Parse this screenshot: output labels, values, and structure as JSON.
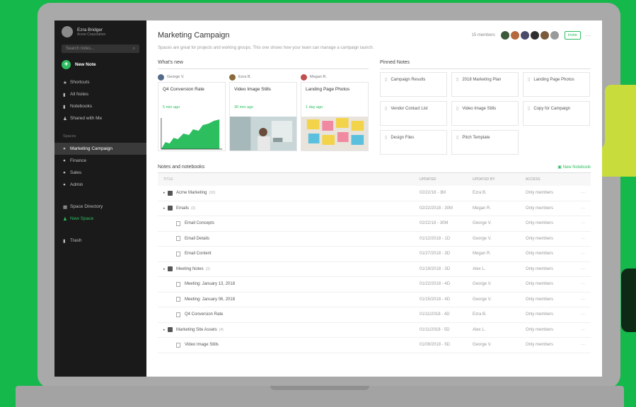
{
  "sidebar": {
    "account_name": "Ezra Bridger",
    "account_org": "Acme Corporation",
    "search_placeholder": "Search notes...",
    "new_note": "New Note",
    "items": [
      {
        "label": "Shortcuts",
        "icon": "star-icon"
      },
      {
        "label": "All Notes",
        "icon": "note-icon"
      },
      {
        "label": "Notebooks",
        "icon": "notebook-icon"
      },
      {
        "label": "Shared with Me",
        "icon": "people-icon"
      }
    ],
    "spaces_label": "Spaces",
    "spaces": [
      {
        "label": "Marketing Campaign",
        "active": true
      },
      {
        "label": "Finance"
      },
      {
        "label": "Sales"
      },
      {
        "label": "Admin"
      }
    ],
    "space_directory": "Space Directory",
    "new_space": "New Space",
    "trash": "Trash"
  },
  "header": {
    "title": "Marketing Campaign",
    "members_count": "15 members",
    "invite": "Invite",
    "description": "Spaces are great for projects and working groups. This one shows how your team can manage a campaign launch."
  },
  "whats_new": {
    "label": "What's new",
    "cards": [
      {
        "author": "George V.",
        "title": "Q4 Conversion Rate",
        "time": "5 min ago"
      },
      {
        "author": "Ezra B.",
        "title": "Video Image Stills",
        "time": "30 min ago"
      },
      {
        "author": "Megan R.",
        "title": "Landing Page Photos",
        "time": "1 day ago"
      }
    ]
  },
  "pinned": {
    "label": "Pinned Notes",
    "items": [
      "Campaign Results",
      "2018 Marketing Plan",
      "Landing Page Photos",
      "Vendor Contact List",
      "Video Image Stills",
      "Copy for Campaign",
      "Design Files",
      "Pitch Template"
    ]
  },
  "notebooks": {
    "label": "Notes and notebooks",
    "new_notebook": "New Notebook",
    "columns": [
      "TITLE",
      "UPDATED",
      "UPDATED BY",
      "ACCESS"
    ],
    "rows": [
      {
        "title": "Acme Marketing",
        "count": "(10)",
        "updated": "02/22/18 - 3M",
        "by": "Ezra B.",
        "access": "Only members",
        "type": "notebook"
      },
      {
        "title": "Emails",
        "count": "(3)",
        "updated": "02/22/2018 - 30M",
        "by": "Megan R.",
        "access": "Only members",
        "type": "notebook"
      },
      {
        "title": "Email Concepts",
        "count": "",
        "updated": "02/22/18 - 30M",
        "by": "George V.",
        "access": "Only members",
        "type": "note"
      },
      {
        "title": "Email Details",
        "count": "",
        "updated": "01/12/2018 - 1D",
        "by": "George V.",
        "access": "Only members",
        "type": "note"
      },
      {
        "title": "Email Content",
        "count": "",
        "updated": "01/27/2018 - 3D",
        "by": "Megan R.",
        "access": "Only members",
        "type": "note"
      },
      {
        "title": "Meeting Notes",
        "count": "(3)",
        "updated": "01/19/2018 - 3D",
        "by": "Alex L.",
        "access": "Only members",
        "type": "notebook"
      },
      {
        "title": "Meeting: January 13, 2018",
        "count": "",
        "updated": "01/22/2018 - 4D",
        "by": "George V.",
        "access": "Only members",
        "type": "note"
      },
      {
        "title": "Meeting: January 06, 2018",
        "count": "",
        "updated": "01/15/2018 - 4D",
        "by": "George V.",
        "access": "Only members",
        "type": "note"
      },
      {
        "title": "Q4 Conversion Rate",
        "count": "",
        "updated": "01/11/2018 - 4D",
        "by": "Ezra B.",
        "access": "Only members",
        "type": "note"
      },
      {
        "title": "Marketing Site Assets",
        "count": "(4)",
        "updated": "01/11/2018 - 5D",
        "by": "Alex L.",
        "access": "Only members",
        "type": "notebook"
      },
      {
        "title": "Video Image Stills",
        "count": "",
        "updated": "01/09/2018 - 5D",
        "by": "George V.",
        "access": "Only members",
        "type": "note"
      }
    ]
  },
  "colors": {
    "brand_green": "#2dbe60",
    "background_green": "#14b84b",
    "lime_accent": "#c8dc3c"
  }
}
